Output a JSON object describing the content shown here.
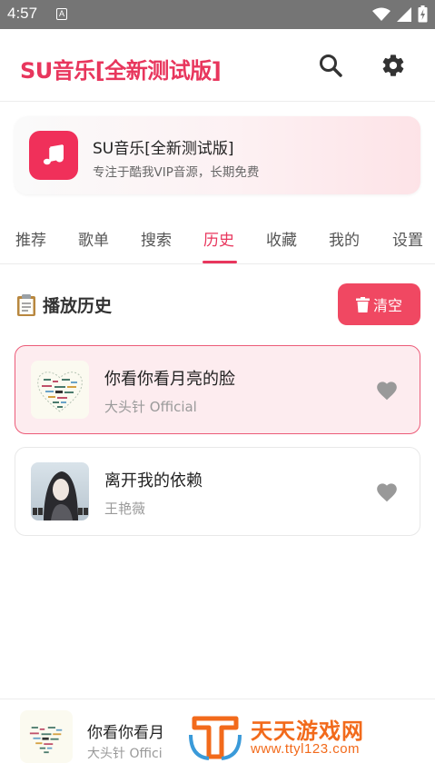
{
  "status_bar": {
    "time": "4:57",
    "notification_glyph": "A"
  },
  "app_bar": {
    "title": "SU音乐[全新测试版]",
    "accent_color": "#e8365d"
  },
  "banner": {
    "title": "SU音乐[全新测试版]",
    "subtitle": "专注于酷我VIP音源，长期免费"
  },
  "tabs": [
    {
      "label": "推荐"
    },
    {
      "label": "歌单"
    },
    {
      "label": "搜索"
    },
    {
      "label": "历史",
      "active": true
    },
    {
      "label": "收藏"
    },
    {
      "label": "我的"
    },
    {
      "label": "设置"
    }
  ],
  "history": {
    "title": "播放历史",
    "clear_label": "清空",
    "songs": [
      {
        "name": "你看你看月亮的脸",
        "artist": "大头针 Official",
        "playing": true
      },
      {
        "name": "离开我的依赖",
        "artist": "王艳薇",
        "playing": false
      }
    ]
  },
  "mini_player": {
    "title": "你看你看月",
    "artist": "大头针 Offici"
  },
  "watermark": {
    "text": "天天游戏网",
    "url": "www.ttyl123.com"
  }
}
